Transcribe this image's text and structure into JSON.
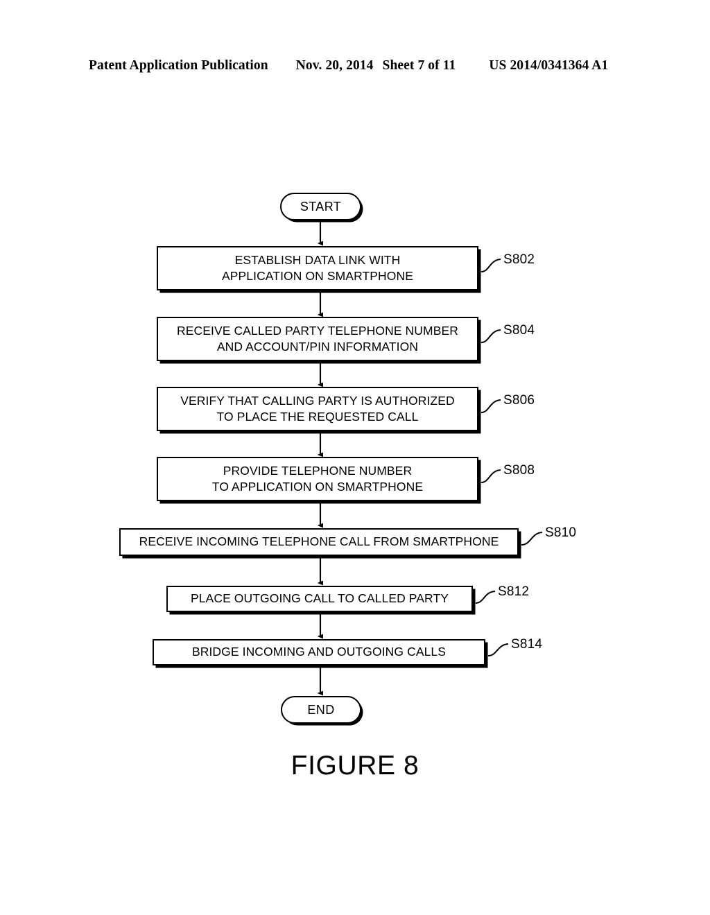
{
  "header": {
    "publication": "Patent Application Publication",
    "date": "Nov. 20, 2014",
    "sheet": "Sheet 7 of 11",
    "patent_number": "US 2014/0341364 A1"
  },
  "figure": {
    "caption": "FIGURE 8",
    "start_label": "START",
    "end_label": "END",
    "steps": [
      {
        "id": "S802",
        "line1": "ESTABLISH DATA LINK WITH",
        "line2": "APPLICATION ON SMARTPHONE"
      },
      {
        "id": "S804",
        "line1": "RECEIVE CALLED PARTY TELEPHONE NUMBER",
        "line2": "AND ACCOUNT/PIN INFORMATION"
      },
      {
        "id": "S806",
        "line1": "VERIFY THAT CALLING PARTY IS AUTHORIZED",
        "line2": "TO PLACE THE REQUESTED CALL"
      },
      {
        "id": "S808",
        "line1": "PROVIDE TELEPHONE NUMBER",
        "line2": "TO APPLICATION ON SMARTPHONE"
      },
      {
        "id": "S810",
        "line1": "RECEIVE INCOMING TELEPHONE CALL FROM SMARTPHONE",
        "line2": ""
      },
      {
        "id": "S812",
        "line1": "PLACE OUTGOING CALL TO CALLED PARTY",
        "line2": ""
      },
      {
        "id": "S814",
        "line1": "BRIDGE INCOMING AND OUTGOING CALLS",
        "line2": ""
      }
    ]
  },
  "colors": {
    "ink": "#000000",
    "paper": "#ffffff"
  }
}
